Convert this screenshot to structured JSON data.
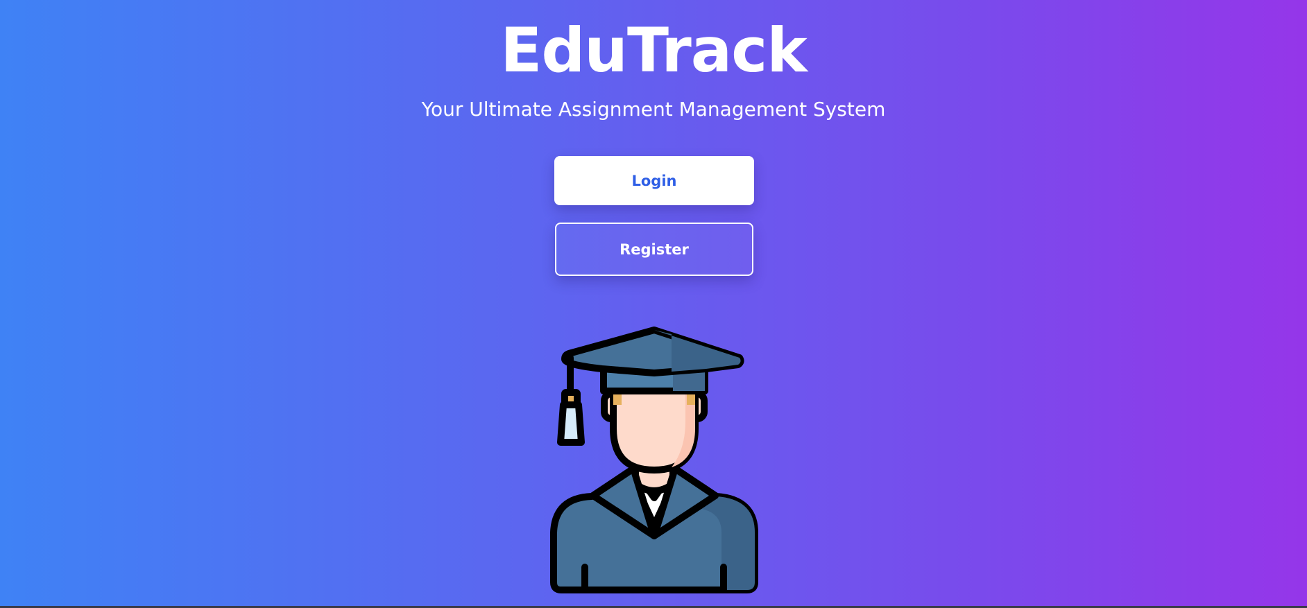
{
  "app": {
    "title": "EduTrack",
    "tagline": "Your Ultimate Assignment Management System"
  },
  "actions": {
    "login_label": "Login",
    "register_label": "Register"
  },
  "illustration": {
    "icon": "graduate-student-icon"
  },
  "colors": {
    "gradient_start": "#3f82f5",
    "gradient_end": "#9536e9",
    "login_text": "#2f5fe6",
    "gown": "#457198",
    "skin": "#fedacb"
  }
}
